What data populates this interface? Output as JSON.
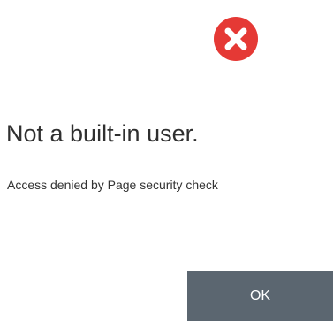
{
  "dialog": {
    "icon": "error-x-circle-icon",
    "icon_color": "#e53935",
    "title": "Not a built-in user.",
    "message": "Access denied by Page security check",
    "ok_label": "OK",
    "ok_button_color": "#5b6670"
  }
}
